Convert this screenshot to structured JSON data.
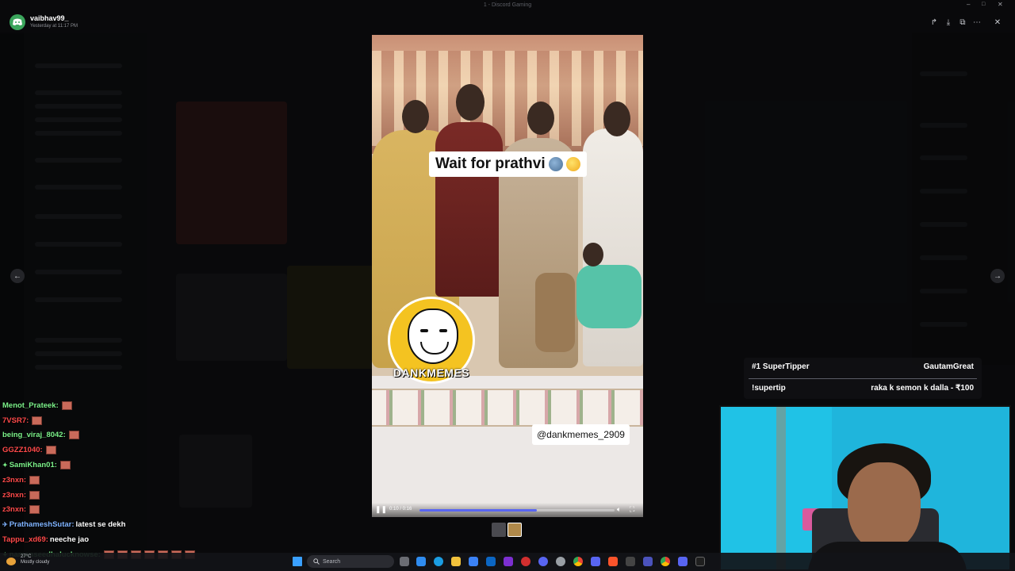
{
  "window": {
    "title": "1 - Discord Gaming"
  },
  "viewer": {
    "username": "vaibhav99_",
    "timestamp": "Yesterday at 11:17 PM",
    "toolbar": [
      "forward-icon",
      "download-icon",
      "open-external-icon",
      "more-icon",
      "close-icon"
    ]
  },
  "video": {
    "caption": "Wait for prathvi",
    "logo_text": "DANKMEMES",
    "watermark": "@dankmemes_2909",
    "time": "0:10 / 0:16",
    "progress": 0.6
  },
  "chat": {
    "messages": [
      {
        "user": "Menot_Prateek:",
        "color": "#7cf28a",
        "text": "",
        "emotes": 1,
        "badge": ""
      },
      {
        "user": "7VSR7:",
        "color": "#ff4a4a",
        "text": "",
        "emotes": 1,
        "badge": ""
      },
      {
        "user": "being_viraj_8042:",
        "color": "#7cf28a",
        "text": "",
        "emotes": 1,
        "badge": ""
      },
      {
        "user": "GGZZ1040:",
        "color": "#ff4a4a",
        "text": "",
        "emotes": 1,
        "badge": ""
      },
      {
        "user": "SamiKhan01:",
        "color": "#7cf28a",
        "text": "",
        "emotes": 1,
        "badge": "✦"
      },
      {
        "user": "z3nxn:",
        "color": "#ff4a4a",
        "text": "",
        "emotes": 1,
        "badge": ""
      },
      {
        "user": "z3nxn:",
        "color": "#ff4a4a",
        "text": "",
        "emotes": 1,
        "badge": ""
      },
      {
        "user": "z3nxn:",
        "color": "#ff4a4a",
        "text": "",
        "emotes": 1,
        "badge": ""
      },
      {
        "user": "PrathameshSutar:",
        "color": "#7fb3ff",
        "text": "latest se dekh",
        "emotes": 0,
        "badge": "✈"
      },
      {
        "user": "Tappu_xd69:",
        "color": "#ff4a4a",
        "text": "neeche jao",
        "emotes": 0,
        "badge": ""
      },
      {
        "user": "namanseedhalucknowse:",
        "color": "#7cf28a",
        "text": "",
        "emotes": 7,
        "badge": "✦"
      }
    ]
  },
  "supertip": {
    "rank_label": "#1 SuperTipper",
    "rank_user": "GautamGreat",
    "command": "!supertip",
    "message": "raka k semon k dalla - ₹100"
  },
  "taskbar": {
    "search_placeholder": "Search",
    "weather_temp": "27°C",
    "weather_desc": "Mostly cloudy"
  },
  "colors": {
    "accent": "#5865f2",
    "discord_green": "#3ba55c",
    "webcam_bg": "#1fb5dc",
    "logo_yellow": "#f4c321"
  }
}
